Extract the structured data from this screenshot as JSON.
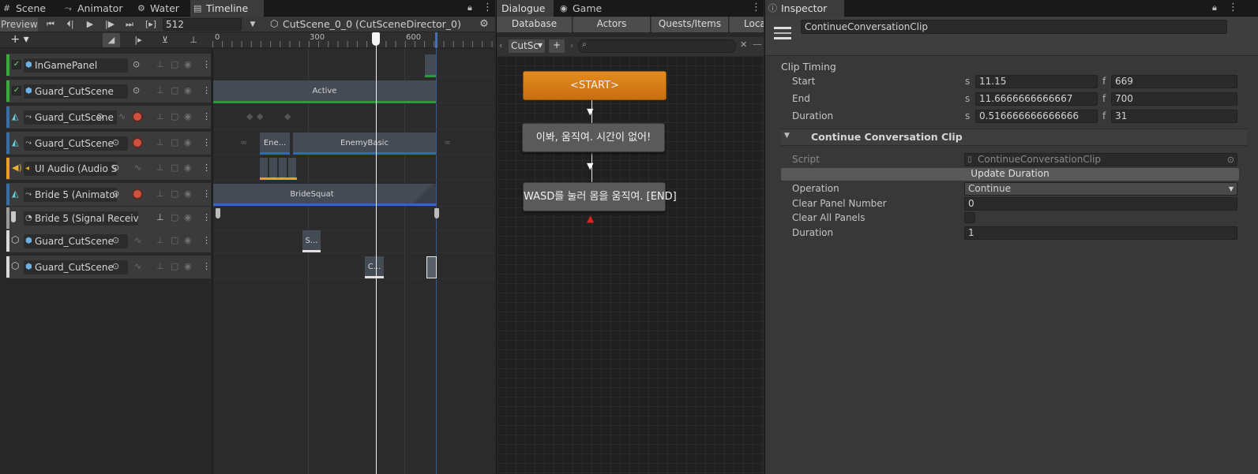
{
  "timeline_panel": {
    "tabs": [
      {
        "icon": "scene-icon",
        "label": "Scene"
      },
      {
        "icon": "animator-icon",
        "label": "Animator"
      },
      {
        "icon": "water-icon",
        "label": "Water"
      },
      {
        "icon": "timeline-icon",
        "label": "Timeline"
      }
    ],
    "preview_label": "Preview",
    "frame_value": "512",
    "director_label": "CutScene_0_0 (CutSceneDirector_0)",
    "ruler": [
      "0",
      "300",
      "600"
    ],
    "tracks": [
      {
        "name": "InGamePanel",
        "color": "#3aa93a",
        "checkbox": true,
        "icon": "gameobject-icon"
      },
      {
        "name": "Guard_CutScene",
        "color": "#3aa93a",
        "checkbox": true,
        "icon": "gameobject-icon"
      },
      {
        "name": "Guard_CutScene",
        "color": "#3a6ea5",
        "checkbox": false,
        "icon": "animator-track-icon"
      },
      {
        "name": "Guard_CutScene",
        "color": "#3a6ea5",
        "checkbox": false,
        "icon": "animator-track-icon"
      },
      {
        "name": "UI Audio (Audio S",
        "color": "#e8a020",
        "checkbox": false,
        "icon": "audio-icon"
      },
      {
        "name": "Bride 5 (Animator",
        "color": "#3a6ea5",
        "checkbox": false,
        "icon": "animator-track-icon"
      },
      {
        "name": "Bride 5 (Signal Receiv",
        "color": "#9a9a9a",
        "checkbox": false,
        "icon": "signal-icon"
      },
      {
        "name": "Guard_CutScene",
        "color": "#d8d8d8",
        "checkbox": false,
        "icon": "gameobject-icon"
      },
      {
        "name": "Guard_CutScene",
        "color": "#d8d8d8",
        "checkbox": false,
        "icon": "gameobject-icon"
      }
    ],
    "clips": {
      "active": "Active",
      "ene": "Ene...",
      "enemy_basic": "EnemyBasic",
      "bride_squat": "BrideSquat",
      "s_clip": "S...",
      "c_clip": "C..."
    }
  },
  "dialogue_panel": {
    "tabs": [
      {
        "label": "Dialogue"
      },
      {
        "label": "Game",
        "icon": "gamepad-icon"
      }
    ],
    "subtabs": [
      "Database",
      "Actors",
      "Quests/Items",
      "Loca"
    ],
    "conversation_select": "CutSc",
    "nodes": {
      "start": "<START>",
      "line1": "이봐, 움직여. 시간이 없어!",
      "line2": "WASD를 눌러 몸을 움직여. [END]"
    }
  },
  "inspector": {
    "tab_label": "Inspector",
    "object_name": "ContinueConversationClip",
    "clip_timing_header": "Clip Timing",
    "timing": [
      {
        "label": "Start",
        "s_unit": "s",
        "s": "11.15",
        "f_unit": "f",
        "f": "669"
      },
      {
        "label": "End",
        "s_unit": "s",
        "s": "11.6666666666667",
        "f_unit": "f",
        "f": "700"
      },
      {
        "label": "Duration",
        "s_unit": "s",
        "s": "0.516666666666666",
        "f_unit": "f",
        "f": "31"
      }
    ],
    "component_header": "Continue Conversation Clip",
    "script_label": "Script",
    "script_value": "ContinueConversationClip",
    "update_button": "Update Duration",
    "operation_label": "Operation",
    "operation_value": "Continue",
    "clear_panel_label": "Clear Panel Number",
    "clear_panel_value": "0",
    "clear_all_label": "Clear All Panels",
    "duration_label": "Duration",
    "duration_value": "1"
  }
}
